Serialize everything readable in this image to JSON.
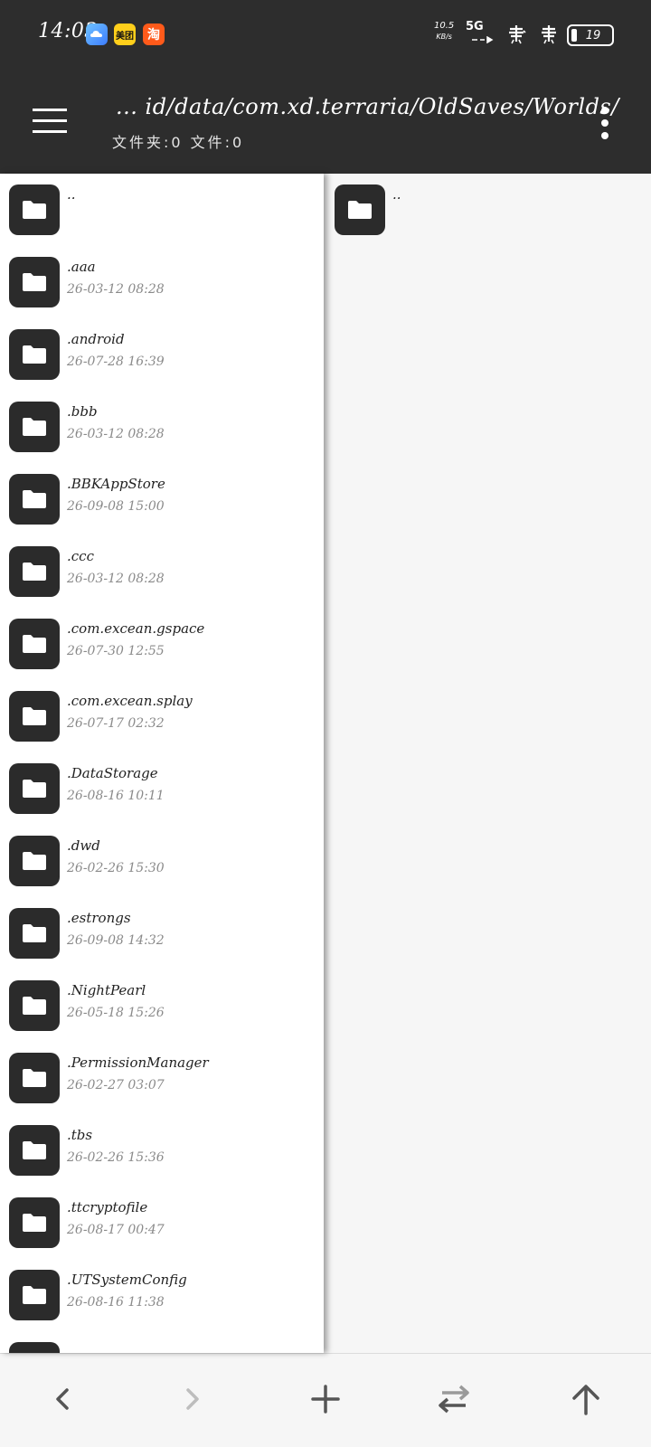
{
  "status": {
    "time": "14:03",
    "apps": [
      {
        "icon": "weather-app-icon",
        "label": ""
      },
      {
        "icon": "meituan-app-icon",
        "label": "美团"
      },
      {
        "icon": "taobao-app-icon",
        "label": "淘"
      }
    ],
    "net_speed_value": "10.5",
    "net_speed_unit": "KB/s",
    "network_type": "5G",
    "battery": "19"
  },
  "header": {
    "path": "... id/data/com.xd.terraria/OldSaves/Worlds/",
    "counts": "文件夹:0 文件:0"
  },
  "left_pane": {
    "items": [
      {
        "name": "..",
        "date": ""
      },
      {
        "name": ".aaa",
        "date": "26-03-12 08:28"
      },
      {
        "name": ".android",
        "date": "26-07-28 16:39"
      },
      {
        "name": ".bbb",
        "date": "26-03-12 08:28"
      },
      {
        "name": ".BBKAppStore",
        "date": "26-09-08 15:00"
      },
      {
        "name": ".ccc",
        "date": "26-03-12 08:28"
      },
      {
        "name": ".com.excean.gspace",
        "date": "26-07-30 12:55"
      },
      {
        "name": ".com.excean.splay",
        "date": "26-07-17 02:32"
      },
      {
        "name": ".DataStorage",
        "date": "26-08-16 10:11"
      },
      {
        "name": ".dwd",
        "date": "26-02-26 15:30"
      },
      {
        "name": ".estrongs",
        "date": "26-09-08 14:32"
      },
      {
        "name": ".NightPearl",
        "date": "26-05-18 15:26"
      },
      {
        "name": ".PermissionManager",
        "date": "26-02-27 03:07"
      },
      {
        "name": ".tbs",
        "date": "26-02-26 15:36"
      },
      {
        "name": ".ttcryptofile",
        "date": "26-08-17 00:47"
      },
      {
        "name": ".UTSystemConfig",
        "date": "26-08-16 11:38"
      },
      {
        "name": "",
        "date": ""
      }
    ]
  },
  "right_pane": {
    "items": [
      {
        "name": "..",
        "date": ""
      }
    ]
  },
  "bottom_nav": [
    "back-arrow-icon",
    "forward-arrow-icon",
    "add-icon",
    "swap-panes-icon",
    "up-directory-icon"
  ],
  "colors": {
    "bar": "#2d2d2d",
    "folder_tile": "#2b2b2b",
    "pane_bg": "#ffffff",
    "secondary_text": "#8a8a8a",
    "forward_disabled": "#bdbdbd"
  }
}
